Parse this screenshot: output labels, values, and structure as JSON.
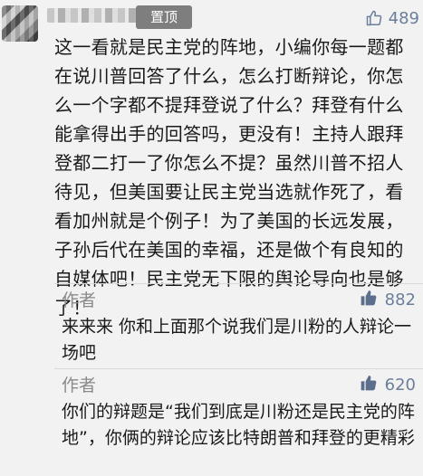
{
  "comment": {
    "pin_label": "置顶",
    "like_count": "489",
    "text": "这一看就是民主党的阵地，小编你每一题都在说川普回答了什么，怎么打断辩论，你怎么一个字都不提拜登说了什么？拜登有什么能拿得出手的回答吗，更没有！主持人跟拜登都二打一了你怎么不提？虽然川普不招人待见，但美国要让民主党当选就作死了，看看加州就是个例子！为了美国的长远发展，子孙后代在美国的幸福，还是做个有良知的自媒体吧！民主党无下限的舆论导向也是够了！"
  },
  "replies": [
    {
      "author": "作者",
      "like_count": "882",
      "text": "来来来 你和上面那个说我们是川粉的人辩论一场吧"
    },
    {
      "author": "作者",
      "like_count": "620",
      "text": "你们的辩题是“我们到底是川粉还是民主党的阵地”，你俩的辩论应该比特朗普和拜登的更精彩"
    }
  ],
  "colors": {
    "accent": "#6b7f9a",
    "pin_badge_bg": "#7e7e7e",
    "reply_like_icon": "#5b6f8c"
  }
}
